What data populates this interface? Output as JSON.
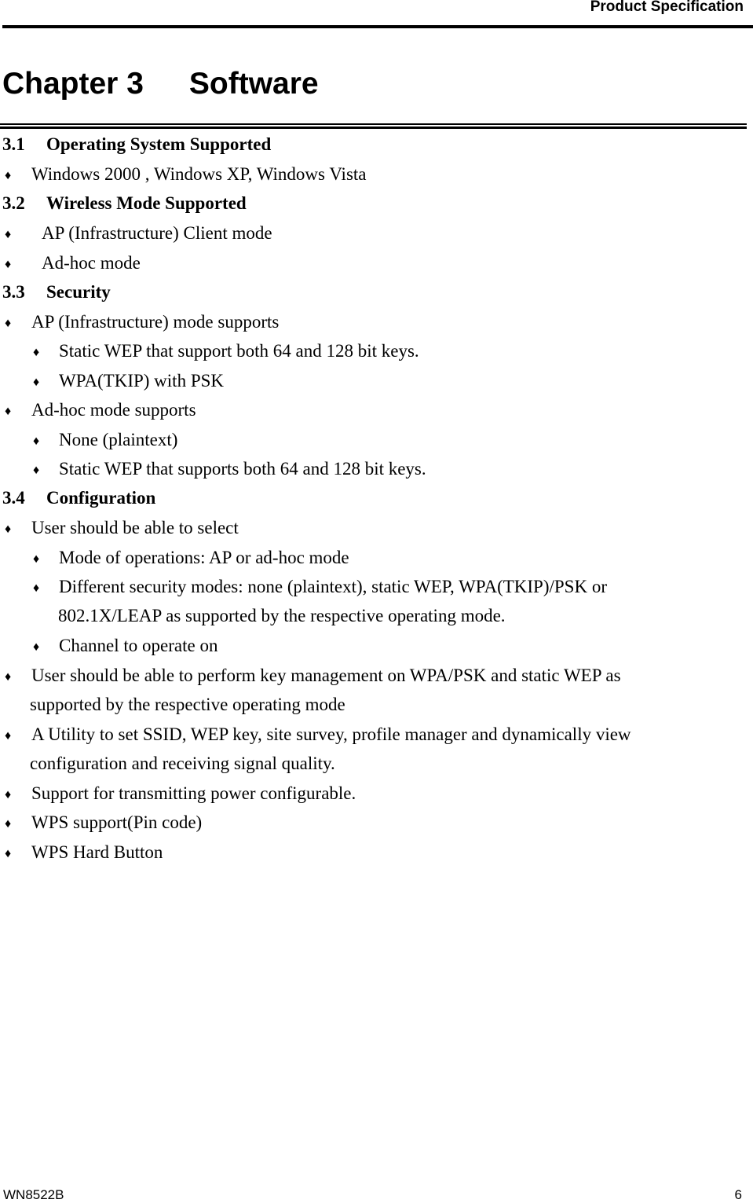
{
  "header": {
    "running_title": "Product Specification"
  },
  "chapter": {
    "number_label": "Chapter 3",
    "title": "Software"
  },
  "sections": [
    {
      "number": "3.1",
      "title": "Operating System Supported",
      "items": [
        {
          "text": "Windows 2000 , Windows XP, Windows Vista"
        }
      ]
    },
    {
      "number": "3.2",
      "title": "Wireless Mode Supported",
      "items": [
        {
          "text": "AP (Infrastructure) Client mode"
        },
        {
          "text": "Ad-hoc mode"
        }
      ]
    },
    {
      "number": "3.3",
      "title": "Security",
      "items": [
        {
          "text": "AP (Infrastructure) mode supports",
          "subitems": [
            "Static WEP that support both 64 and 128 bit keys.",
            "WPA(TKIP) with PSK"
          ]
        },
        {
          "text": "Ad-hoc mode supports",
          "subitems": [
            "None (plaintext)",
            "Static WEP that supports both 64 and 128 bit keys."
          ]
        }
      ]
    },
    {
      "number": "3.4",
      "title": "Configuration",
      "items": [
        {
          "text": "User should be able to select",
          "subitems": [
            "Mode of operations: AP or ad-hoc mode",
            "Different security modes: none (plaintext), static WEP, WPA(TKIP)/PSK or",
            "802.1X/LEAP as supported by the respective operating mode.",
            "Channel to operate on"
          ]
        },
        {
          "text": "User should be able to perform key management on WPA/PSK and static WEP as",
          "continuation": "supported by the respective operating mode"
        },
        {
          "text": "A Utility to set SSID, WEP key, site survey, profile manager and dynamically view",
          "continuation": "configuration and receiving signal quality."
        },
        {
          "text": "Support for transmitting power configurable."
        },
        {
          "text": "WPS support(Pin code)"
        },
        {
          "text": "WPS Hard Button"
        }
      ]
    }
  ],
  "bullet_glyph": "♦",
  "footer": {
    "model": "WN8522B",
    "page_number": "6"
  }
}
